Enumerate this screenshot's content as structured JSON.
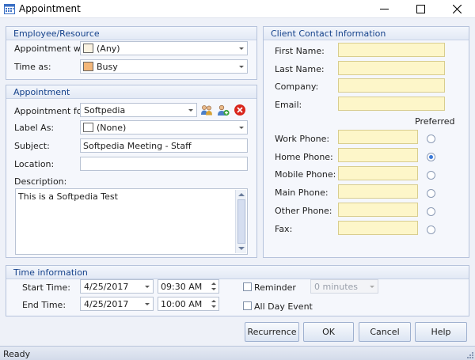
{
  "window": {
    "title": "Appointment"
  },
  "employee_group": {
    "header": "Employee/Resource",
    "appointment_with_label": "Appointment with:",
    "appointment_with_value": "(Any)",
    "time_as_label": "Time as:",
    "time_as_value": "Busy"
  },
  "appointment_group": {
    "header": "Appointment",
    "appointment_for_label": "Appointment for:",
    "appointment_for_value": "Softpedia",
    "label_as_label": "Label As:",
    "label_as_value": "(None)",
    "subject_label": "Subject:",
    "subject_value": "Softpedia Meeting - Staff",
    "location_label": "Location:",
    "location_value": "",
    "description_label": "Description:",
    "description_value": "This is a Softpedia Test"
  },
  "contact_group": {
    "header": "Client Contact Information",
    "preferred_label": "Preferred",
    "fields": [
      {
        "label": "First Name:",
        "value": ""
      },
      {
        "label": "Last Name:",
        "value": ""
      },
      {
        "label": "Company:",
        "value": ""
      },
      {
        "label": "Email:",
        "value": ""
      }
    ],
    "phones": [
      {
        "label": "Work Phone:",
        "value": "",
        "preferred": false
      },
      {
        "label": "Home Phone:",
        "value": "",
        "preferred": true
      },
      {
        "label": "Mobile Phone:",
        "value": "",
        "preferred": false
      },
      {
        "label": "Main Phone:",
        "value": "",
        "preferred": false
      },
      {
        "label": "Other Phone:",
        "value": "",
        "preferred": false
      },
      {
        "label": "Fax:",
        "value": "",
        "preferred": false
      }
    ]
  },
  "time_group": {
    "header": "Time information",
    "start_label": "Start Time:",
    "start_date": "4/25/2017",
    "start_time": "09:30 AM",
    "end_label": "End Time:",
    "end_date": "4/25/2017",
    "end_time": "10:00 AM",
    "reminder_label": "Reminder",
    "reminder_checked": false,
    "reminder_value": "0 minutes",
    "all_day_label": "All Day Event",
    "all_day_checked": false
  },
  "buttons": {
    "recurrence": "Recurrence",
    "ok": "OK",
    "cancel": "Cancel",
    "help": "Help"
  },
  "status": {
    "text": "Ready"
  },
  "colors": {
    "time_as_swatch": "#f4b77a",
    "appointment_with_swatch": "#fbf3e2",
    "label_as_swatch": "#ffffff",
    "contact_field_bg": "#fdf6c9",
    "group_header_text": "#15428b"
  }
}
